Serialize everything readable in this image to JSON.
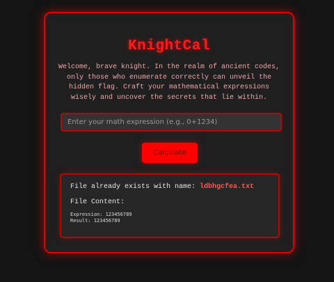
{
  "app": {
    "title": "KnightCal",
    "intro": "Welcome, brave knight. In the realm of ancient codes, only those who enumerate correctly can unveil the hidden flag. Craft your mathematical expressions wisely and uncover the secrets that lie within."
  },
  "form": {
    "input_placeholder": "Enter your math expression (e.g., 0+1234)",
    "input_value": "",
    "button_label": "Calculate"
  },
  "result": {
    "message_prefix": "File already exists with name: ",
    "filename": "ldbhgcfea.txt",
    "content_label": "File Content:",
    "content_lines": [
      "Expression: 123456789",
      "Result: 123456789"
    ]
  },
  "colors": {
    "accent": "#ff0000",
    "background": "#141414",
    "card": "#1f1f1f"
  }
}
